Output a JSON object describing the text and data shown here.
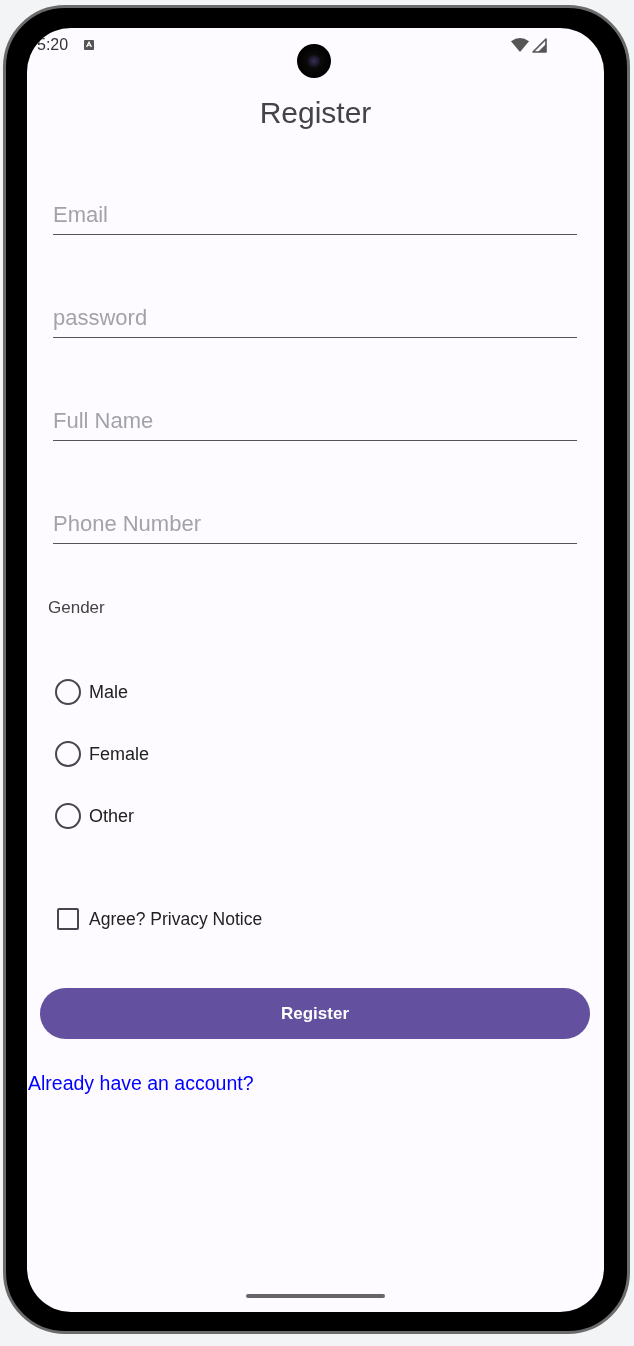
{
  "status_bar": {
    "time": "5:20"
  },
  "title": "Register",
  "fields": [
    {
      "placeholder": "Email"
    },
    {
      "placeholder": "password"
    },
    {
      "placeholder": "Full Name"
    },
    {
      "placeholder": "Phone Number"
    }
  ],
  "gender": {
    "label": "Gender",
    "options": [
      {
        "label": "Male",
        "selected": false
      },
      {
        "label": "Female",
        "selected": false
      },
      {
        "label": "Other",
        "selected": false
      }
    ]
  },
  "agree": {
    "label": "Agree? Privacy Notice",
    "checked": false
  },
  "submit_button": "Register",
  "login_link": "Already have an account?"
}
